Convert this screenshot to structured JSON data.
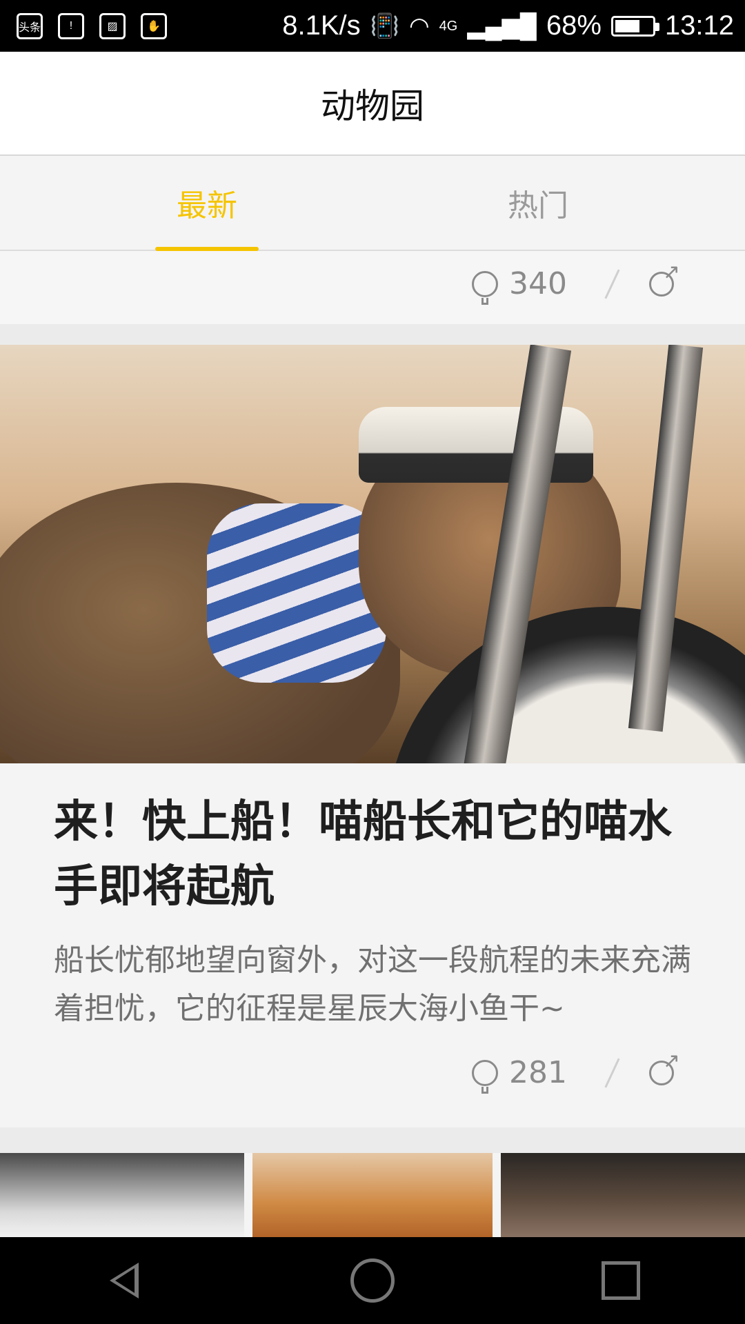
{
  "status_bar": {
    "left_icons": [
      "toutiao-app-icon",
      "battery-alert-icon",
      "image-icon",
      "hand-icon"
    ],
    "toutiao_label": "头条",
    "net_speed": "8.1K/s",
    "network": "4G",
    "battery_percent": "68%",
    "battery_level": 0.68,
    "time": "13:12"
  },
  "header": {
    "title": "动物园"
  },
  "tabs": [
    {
      "label": "最新",
      "active": true
    },
    {
      "label": "热门",
      "active": false
    }
  ],
  "feed": {
    "previous_card": {
      "comment_count": "340"
    },
    "card": {
      "image_alt": "cat-sleeping-on-clock",
      "title": "来！快上船！喵船长和它的喵水手即将起航",
      "description": "船长忧郁地望向窗外，对这一段航程的未来充满着担忧，它的征程是星辰大海小鱼干~",
      "comment_count": "281"
    }
  },
  "colors": {
    "accent": "#f5c400",
    "background": "#f4f4f4",
    "text_primary": "#1f1f1f",
    "text_secondary": "#707070"
  }
}
